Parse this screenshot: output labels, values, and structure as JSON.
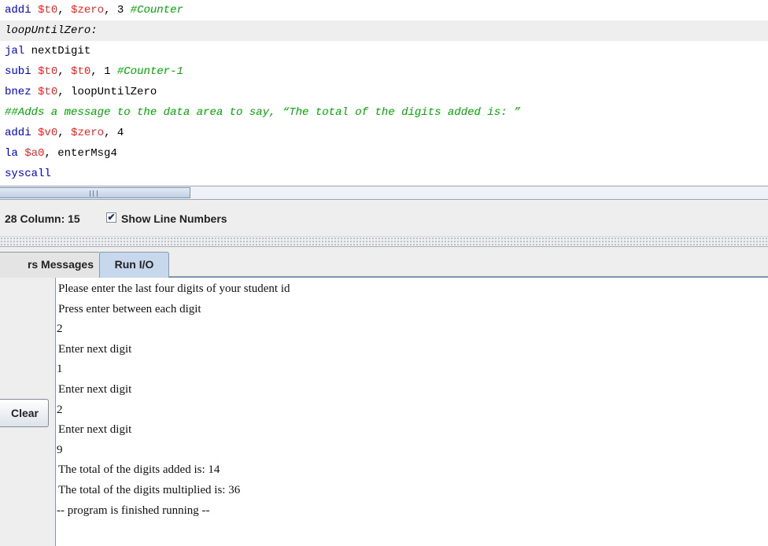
{
  "editor": {
    "lines": [
      {
        "tokens": [
          {
            "t": "addi ",
            "c": "kw"
          },
          {
            "t": "$t0",
            "c": "reg"
          },
          {
            "t": ", ",
            "c": "txt"
          },
          {
            "t": "$zero",
            "c": "reg"
          },
          {
            "t": ", 3 ",
            "c": "txt"
          },
          {
            "t": "#Counter",
            "c": "com"
          }
        ]
      },
      {
        "tokens": [
          {
            "t": "loopUntilZero:",
            "c": "lbl"
          }
        ],
        "current": true
      },
      {
        "tokens": [
          {
            "t": "jal ",
            "c": "kw"
          },
          {
            "t": "nextDigit",
            "c": "txt"
          }
        ]
      },
      {
        "tokens": [
          {
            "t": "subi ",
            "c": "kw"
          },
          {
            "t": "$t0",
            "c": "reg"
          },
          {
            "t": ", ",
            "c": "txt"
          },
          {
            "t": "$t0",
            "c": "reg"
          },
          {
            "t": ", 1 ",
            "c": "txt"
          },
          {
            "t": "#Counter-1",
            "c": "com"
          }
        ]
      },
      {
        "tokens": [
          {
            "t": "bnez ",
            "c": "kw"
          },
          {
            "t": "$t0",
            "c": "reg"
          },
          {
            "t": ", loopUntilZero",
            "c": "txt"
          }
        ]
      },
      {
        "tokens": [
          {
            "t": "##Adds a message to the data area to say, “The total of the digits added is: ”",
            "c": "com"
          }
        ]
      },
      {
        "tokens": [
          {
            "t": "addi ",
            "c": "kw"
          },
          {
            "t": "$v0",
            "c": "reg"
          },
          {
            "t": ", ",
            "c": "txt"
          },
          {
            "t": "$zero",
            "c": "reg"
          },
          {
            "t": ", 4",
            "c": "txt"
          }
        ]
      },
      {
        "tokens": [
          {
            "t": "la ",
            "c": "kw"
          },
          {
            "t": "$a0",
            "c": "reg"
          },
          {
            "t": ", enterMsg4",
            "c": "txt"
          }
        ]
      },
      {
        "tokens": [
          {
            "t": "syscall",
            "c": "kw"
          }
        ]
      }
    ]
  },
  "status": {
    "position_text": "28 Column: 15",
    "show_line_numbers_label": "Show Line Numbers",
    "show_line_numbers_checked": "✔"
  },
  "tabs": {
    "messages_label": "rs Messages",
    "run_io_label": "Run I/O"
  },
  "io": {
    "clear_label": "Clear",
    "console_lines": [
      {
        "text": "Please enter the last four digits of your student id",
        "input": false
      },
      {
        "text": "Press enter between each digit",
        "input": false
      },
      {
        "text": "2",
        "input": true
      },
      {
        "text": "Enter next digit",
        "input": false
      },
      {
        "text": "1",
        "input": true
      },
      {
        "text": "Enter next digit",
        "input": false
      },
      {
        "text": "2",
        "input": true
      },
      {
        "text": "Enter next digit",
        "input": false
      },
      {
        "text": "9",
        "input": true
      },
      {
        "text": "The total of the digits added is: 14",
        "input": false
      },
      {
        "text": "The total of the digits multiplied is: 36",
        "input": false
      },
      {
        "text": "-- program is finished running --",
        "input": true
      }
    ]
  }
}
